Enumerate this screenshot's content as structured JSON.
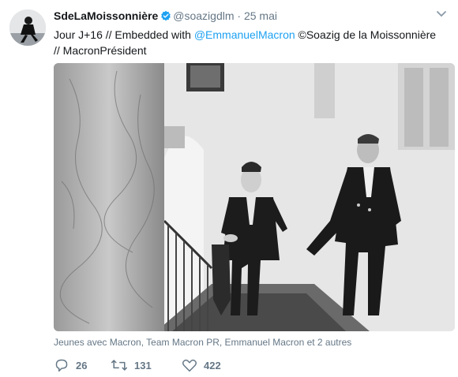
{
  "tweet": {
    "author_name": "SdeLaMoissonnière",
    "author_handle": "@soazigdlm",
    "separator": "·",
    "time": "25 mai",
    "text_prefix": "Jour J+16 // Embedded with ",
    "mention": "@EmmanuelMacron",
    "text_suffix": " ©Soazig de la Moissonnière",
    "text_line2": "//  MacronPrésident",
    "tagged_people": "Jeunes avec Macron, Team Macron PR, Emmanuel Macron et 2 autres",
    "reply_count": "26",
    "retweet_count": "131",
    "like_count": "422"
  },
  "colors": {
    "link": "#1da1f2",
    "secondary_text": "#657786",
    "verified": "#1da1f2"
  },
  "icons": [
    "verified-badge-icon",
    "chevron-down-icon",
    "reply-icon",
    "retweet-icon",
    "like-icon"
  ]
}
